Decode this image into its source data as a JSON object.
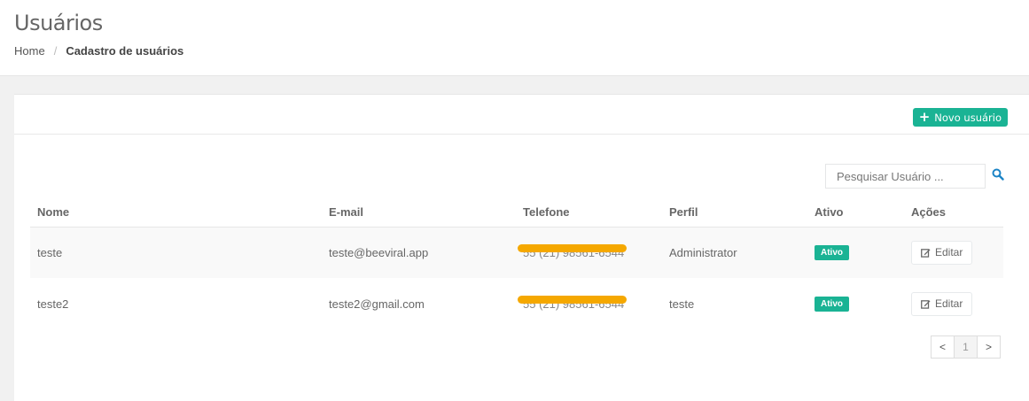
{
  "header": {
    "title": "Usuários",
    "breadcrumb": {
      "home": "Home",
      "separator": "/",
      "current": "Cadastro de usuários"
    }
  },
  "toolbar": {
    "new_user_label": "Novo usuário",
    "new_user_icon": "plus-icon"
  },
  "search": {
    "placeholder": "Pesquisar Usuário ...",
    "icon": "search-icon"
  },
  "table": {
    "columns": [
      "Nome",
      "E-mail",
      "Telefone",
      "Perfil",
      "Ativo",
      "Ações"
    ],
    "rows": [
      {
        "nome": "teste",
        "email": "teste@beeviral.app",
        "telefone": "55 (21) 98561-6544",
        "perfil": "Administrator",
        "ativo": "Ativo",
        "acao": "Editar"
      },
      {
        "nome": "teste2",
        "email": "teste2@gmail.com",
        "telefone": "55 (21) 98561-6544",
        "perfil": "teste",
        "ativo": "Ativo",
        "acao": "Editar"
      }
    ]
  },
  "pagination": {
    "prev": "<",
    "current": "1",
    "next": ">"
  },
  "colors": {
    "accent": "#1ab394",
    "redaction": "#f5a800"
  }
}
